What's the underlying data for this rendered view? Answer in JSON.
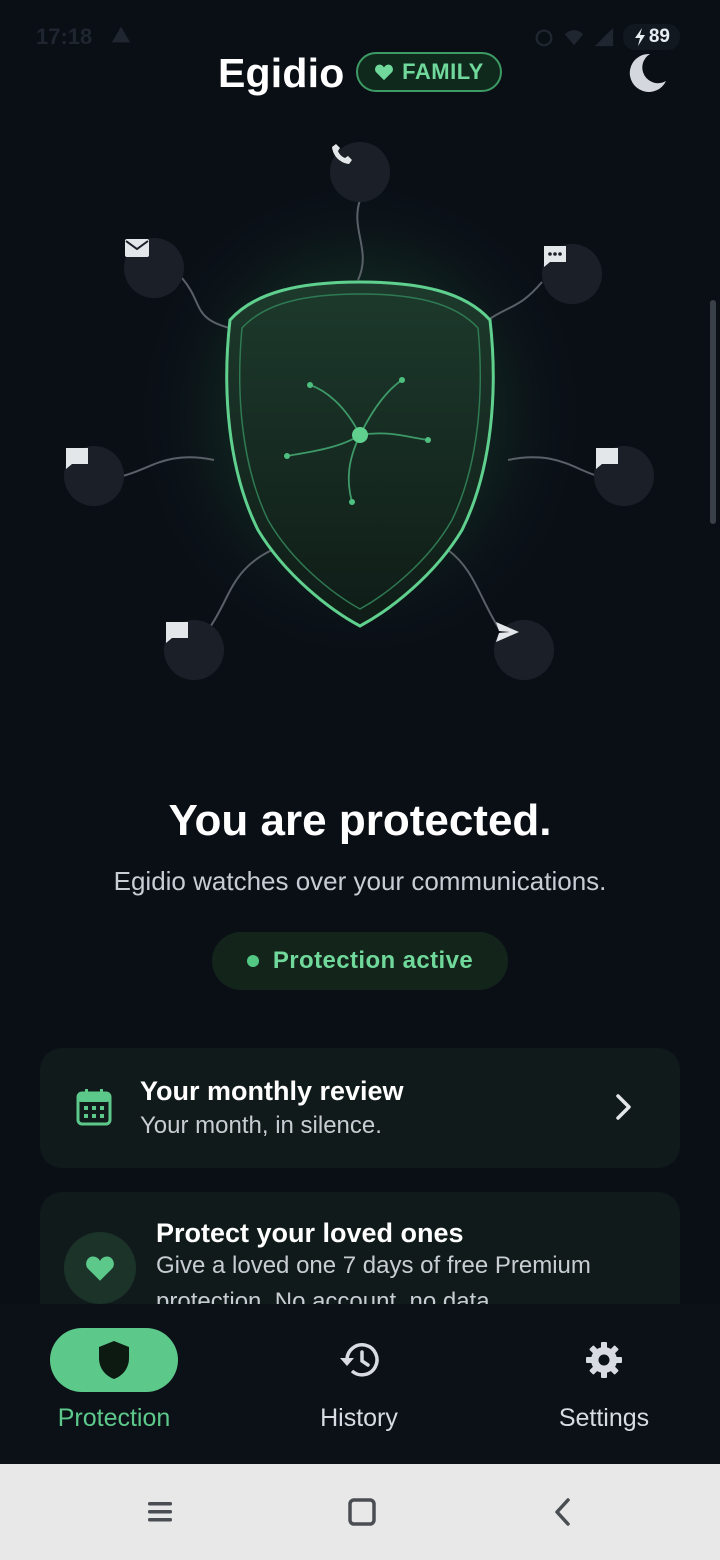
{
  "status_bar": {
    "time": "17:18",
    "battery": "89"
  },
  "header": {
    "title": "Egidio",
    "badge": "FAMILY"
  },
  "hero": {
    "nodes": [
      "phone-icon",
      "mail-icon",
      "chat-dots-icon",
      "chat-icon",
      "chat-icon",
      "chat-icon",
      "send-icon"
    ]
  },
  "main": {
    "headline": "You are protected.",
    "subheadline": "Egidio watches over your communications.",
    "status": "Protection active"
  },
  "cards": {
    "monthly": {
      "title": "Your monthly review",
      "subtitle": "Your month, in silence."
    },
    "loved": {
      "title": "Protect your loved ones",
      "line1": "Give a loved one 7 days of free Premium",
      "line2": "protection. No account, no data."
    }
  },
  "nav": {
    "protection": "Protection",
    "history": "History",
    "settings": "Settings"
  },
  "colors": {
    "accent": "#5cc98a",
    "background": "#0a0f16",
    "card": "#111a1a"
  }
}
